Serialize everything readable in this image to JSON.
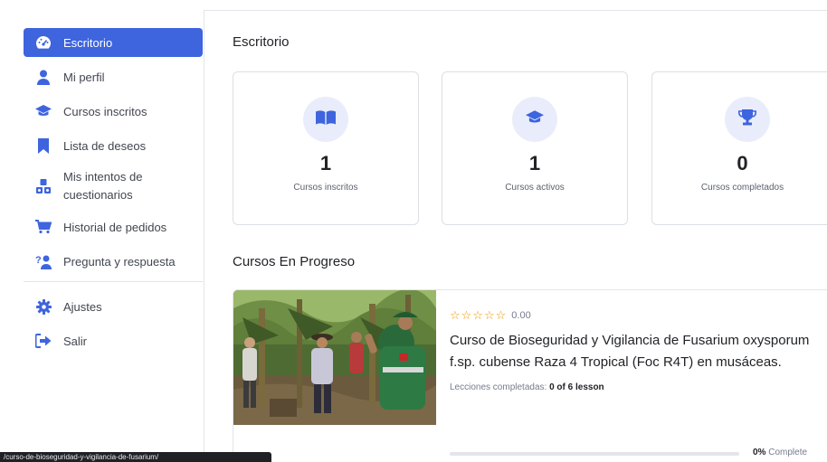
{
  "sidebar": {
    "items": [
      {
        "label": "Escritorio",
        "icon": "dashboard-icon",
        "active": true
      },
      {
        "label": "Mi perfil",
        "icon": "user-icon"
      },
      {
        "label": "Cursos inscritos",
        "icon": "graduation-cap-icon"
      },
      {
        "label": "Lista de deseos",
        "icon": "bookmark-icon"
      },
      {
        "label": "Mis intentos de cuestionarios",
        "icon": "quiz-attempts-icon"
      },
      {
        "label": "Historial de pedidos",
        "icon": "cart-icon"
      },
      {
        "label": "Pregunta y respuesta",
        "icon": "question-answer-icon"
      }
    ],
    "bottom_items": [
      {
        "label": "Ajustes",
        "icon": "gear-icon"
      },
      {
        "label": "Salir",
        "icon": "logout-icon"
      }
    ]
  },
  "main": {
    "title": "Escritorio",
    "stats": [
      {
        "value": "1",
        "label": "Cursos inscritos",
        "icon": "book-icon"
      },
      {
        "value": "1",
        "label": "Cursos activos",
        "icon": "graduation-cap-icon"
      },
      {
        "value": "0",
        "label": "Cursos completados",
        "icon": "trophy-icon"
      }
    ],
    "in_progress_title": "Cursos En Progreso",
    "course": {
      "stars": "☆☆☆☆☆",
      "rating": "0.00",
      "title": "Curso de Bioseguridad y Vigilancia de Fusarium oxysporum f.sp. cubense Raza 4 Tropical (Foc R4T) en musáceas.",
      "lessons_label": "Lecciones completadas:",
      "lessons_value": "0 of 6 lesson",
      "progress_percent": 0,
      "progress_value": "0%",
      "progress_label": "Complete"
    }
  },
  "status_url": "/curso-de-bioseguridad-y-vigilancia-de-fusarium/",
  "colors": {
    "accent": "#3e64de",
    "icon_bg": "#e9edfb",
    "star": "#ed9700"
  }
}
